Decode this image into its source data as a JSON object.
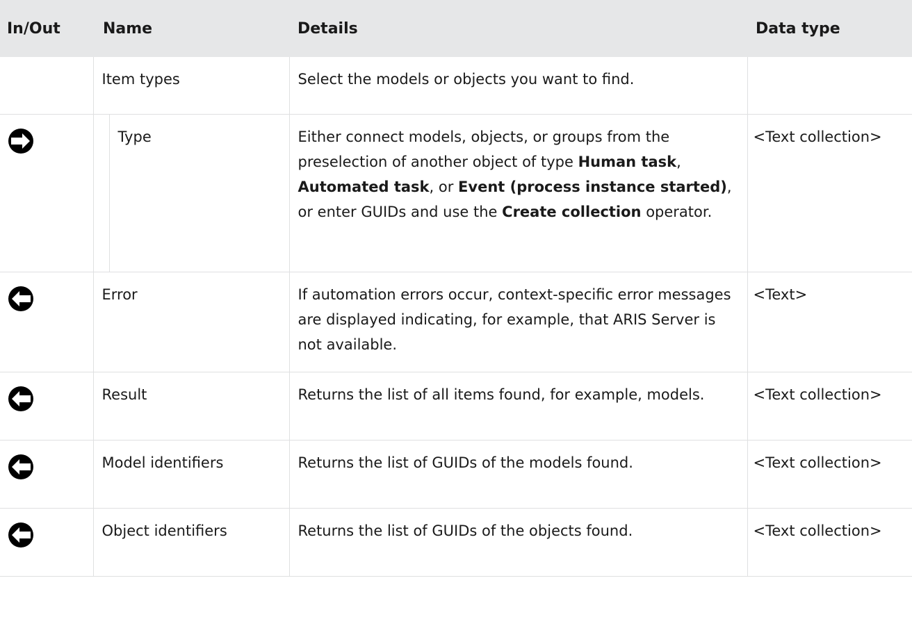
{
  "headers": {
    "inout": "In/Out",
    "name": "Name",
    "details": "Details",
    "datatype": "Data type"
  },
  "icons": {
    "input": "arrow-right-icon",
    "output": "arrow-left-icon",
    "color": "#000000"
  },
  "rows": [
    {
      "direction": "",
      "name": "Item types",
      "details": "Select the models or objects you want to find.",
      "datatype": ""
    },
    {
      "direction": "input",
      "name": "Type",
      "details": {
        "t1": "Either connect models, objects, or groups from the preselection of another object of type ",
        "b1": "Human task",
        "t2": ", ",
        "b2": "Automated task",
        "t3": ", or ",
        "b3": "Event (process instance started)",
        "t4": ", or enter GUIDs and use the ",
        "b4": "Create collection",
        "t5": " operator."
      },
      "datatype": "<Text collection>"
    },
    {
      "direction": "output",
      "name": "Error",
      "details": "If automation errors occur, context-specific error messages are displayed indicating, for example, that ARIS Server is not available.",
      "datatype": "<Text>"
    },
    {
      "direction": "output",
      "name": "Result",
      "details": "Returns the list of all items found, for example, models.",
      "datatype": "<Text collection>"
    },
    {
      "direction": "output",
      "name": "Model identifiers",
      "details": "Returns the list of GUIDs of the models found.",
      "datatype": "<Text collection>"
    },
    {
      "direction": "output",
      "name": "Object identifiers",
      "details": "Returns the list of GUIDs of the objects found.",
      "datatype": "<Text collection>"
    }
  ]
}
